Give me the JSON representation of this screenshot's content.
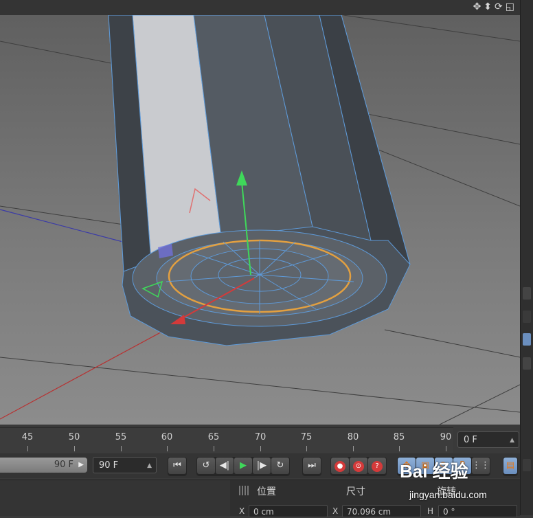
{
  "viewport": {
    "nav_icons": [
      "move-view-icon",
      "pan-view-icon",
      "rotate-view-icon",
      "maximize-view-icon"
    ]
  },
  "timeline": {
    "ticks": [
      "45",
      "50",
      "55",
      "60",
      "65",
      "70",
      "75",
      "80",
      "85",
      "90"
    ],
    "current_frame": "0 F"
  },
  "transport": {
    "slider_value": "90 F",
    "end_frame": "90 F",
    "buttons": [
      "go-to-start",
      "previous-key",
      "previous-frame",
      "play",
      "next-frame",
      "next-key",
      "go-to-end"
    ]
  },
  "attributes": {
    "position_label": "位置",
    "size_label": "尺寸",
    "rotation_label": "旋转",
    "x_label": "X",
    "h_label": "H",
    "pos_x": "0 cm",
    "size_x": "70.096 cm",
    "rot_h": "0 °"
  },
  "watermark": {
    "logo": "Bai 经验",
    "url": "jingyan.baidu.com"
  }
}
